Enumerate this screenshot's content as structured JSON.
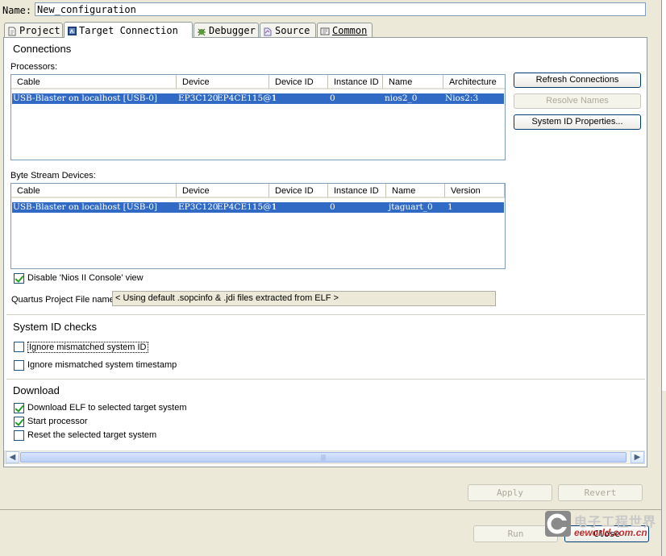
{
  "name_label": "Name:",
  "name_value": "New_configuration",
  "tabs": [
    {
      "label": "Project"
    },
    {
      "label": "Target Connection"
    },
    {
      "label": "Debugger"
    },
    {
      "label": "Source"
    },
    {
      "label": "Common"
    }
  ],
  "connections": {
    "title": "Connections",
    "processors_label": "Processors:",
    "processors_headers": [
      "Cable",
      "Device",
      "Device ID",
      "Instance ID",
      "Name",
      "Architecture"
    ],
    "processors_row": [
      "USB-Blaster on localhost [USB-0]",
      "EP3C120",
      "EP4CE115@1",
      "1",
      "0",
      "nios2_0",
      "Nios2:3"
    ],
    "bytestream_label": "Byte Stream Devices:",
    "bytestream_headers": [
      "Cable",
      "Device",
      "Device ID",
      "Instance ID",
      "Name",
      "Version"
    ],
    "bytestream_row": [
      "USB-Blaster on localhost [USB-0]",
      "EP3C120",
      "EP4CE115@1",
      "1",
      "0",
      "jtaguart_0",
      "1"
    ],
    "refresh_button": "Refresh Connections",
    "resolve_button": "Resolve Names",
    "sysid_button": "System ID Properties...",
    "disable_console_label": "Disable 'Nios II Console' view",
    "quartus_label": "Quartus Project File name:",
    "quartus_value": "< Using default .sopcinfo & .jdi files extracted from ELF >"
  },
  "sysid": {
    "title": "System ID checks",
    "ignore_id": "Ignore mismatched system ID",
    "ignore_ts": "Ignore mismatched system timestamp"
  },
  "download": {
    "title": "Download",
    "download_elf": "Download ELF to selected target system",
    "start_processor": "Start processor",
    "reset_target": "Reset the selected target system"
  },
  "footer": {
    "apply": "Apply",
    "revert": "Revert",
    "run": "Run",
    "close": "Close"
  },
  "watermark": {
    "cn": "电子工程世界",
    "url": "eeworld.com.cn"
  }
}
